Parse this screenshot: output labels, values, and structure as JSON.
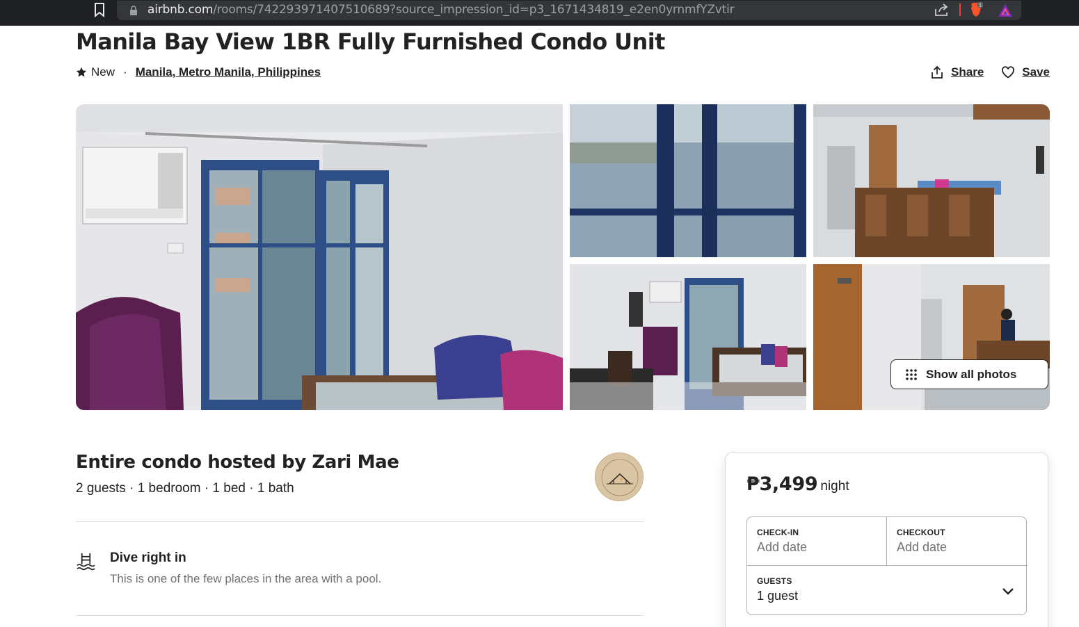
{
  "browser": {
    "url_domain": "airbnb.com",
    "url_path": "/rooms/742293971407510689?source_impression_id=p3_1671434819_e2en0yrnmfYZvtir",
    "brave_badge": "1"
  },
  "listing": {
    "title": "Manila Bay View 1BR Fully Furnished Condo Unit",
    "rating_label": "New",
    "separator": "·",
    "location": "Manila, Metro Manila, Philippines",
    "share_label": "Share",
    "save_label": "Save"
  },
  "gallery": {
    "show_all_label": "Show all photos"
  },
  "host": {
    "title": "Entire condo hosted by Zari Mae",
    "details": "2 guests · 1 bedroom · 1 bed · 1 bath"
  },
  "highlights": [
    {
      "icon": "pool-icon",
      "title": "Dive right in",
      "description": "This is one of the few places in the area with a pool."
    }
  ],
  "booking": {
    "price": "₱3,499",
    "per": "night",
    "checkin_label": "CHECK-IN",
    "checkin_value": "Add date",
    "checkout_label": "CHECKOUT",
    "checkout_value": "Add date",
    "guests_label": "GUESTS",
    "guests_value": "1 guest"
  }
}
